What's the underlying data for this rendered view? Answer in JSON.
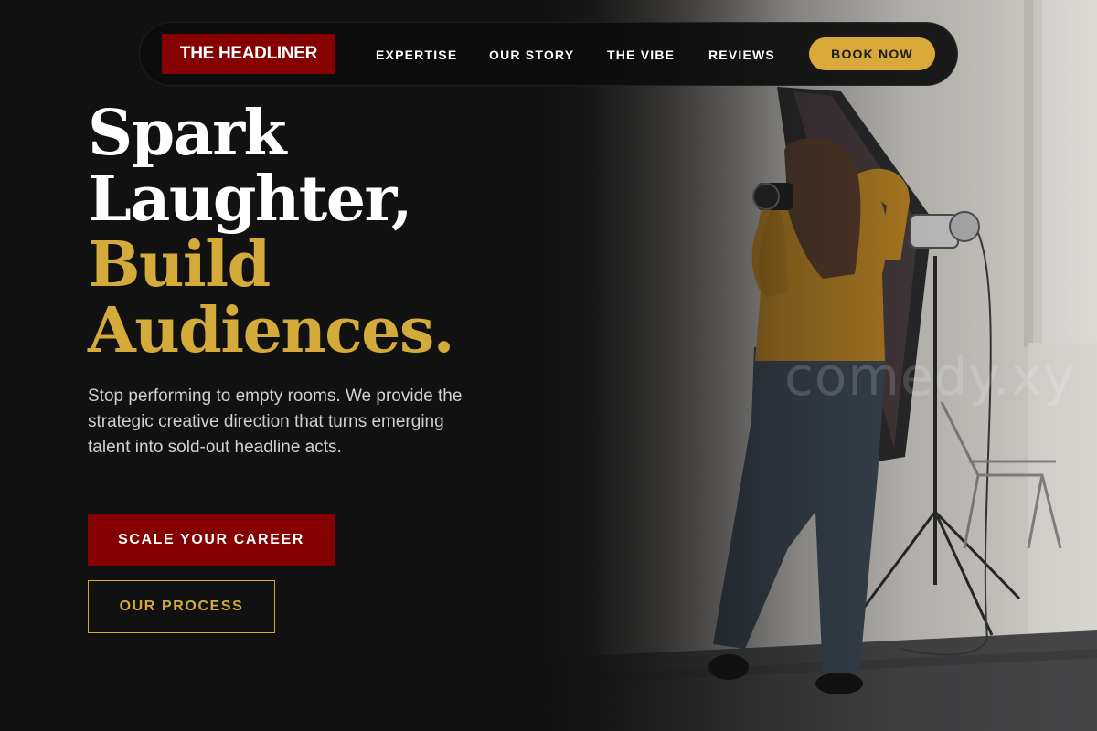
{
  "brand": {
    "logo_text": "THE HEADLINER",
    "logo_bg": "#850000",
    "accent_gold": "#d4ab3a",
    "button_gold": "#d9a93a"
  },
  "nav": {
    "links": [
      "EXPERTISE",
      "OUR STORY",
      "THE VIBE",
      "REVIEWS"
    ],
    "cta_label": "BOOK NOW"
  },
  "hero": {
    "headline_line1": "Spark",
    "headline_line2": "Laughter,",
    "headline_line3": "Build",
    "headline_line4": "Audiences.",
    "lead": "Stop performing to empty rooms. We provide the strategic creative direction that turns emerging talent into sold-out headline acts.",
    "primary_cta": "SCALE YOUR CAREER",
    "secondary_cta": "OUR PROCESS",
    "image_watermark": "comedy.xy",
    "image_subject": "photographer-in-studio"
  }
}
